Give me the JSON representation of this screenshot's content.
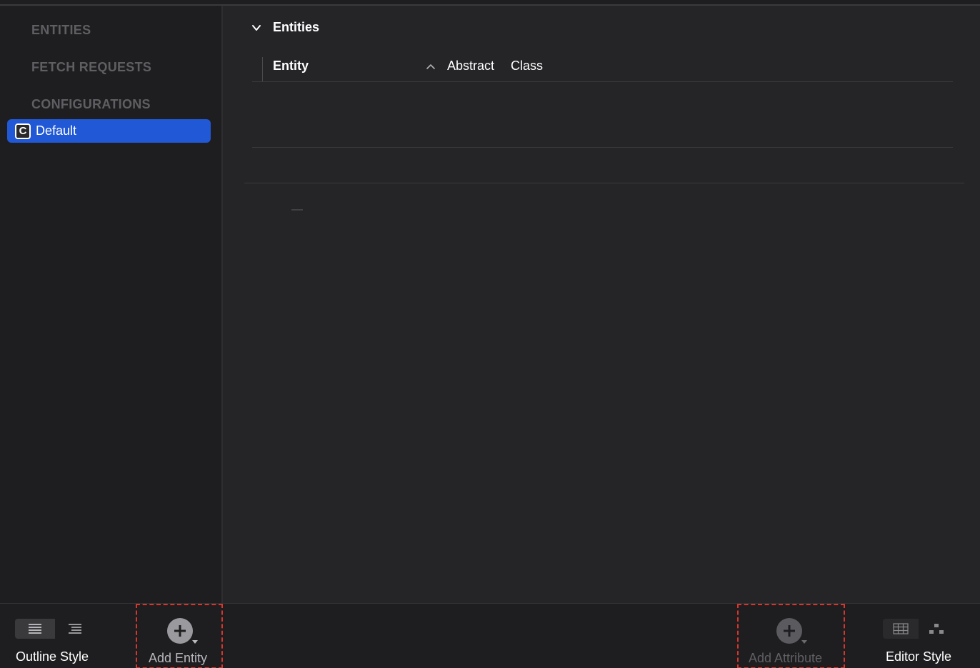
{
  "sidebar": {
    "sections": {
      "entities": "ENTITIES",
      "fetch_requests": "FETCH REQUESTS",
      "configurations": "CONFIGURATIONS"
    },
    "items": [
      {
        "label": "Default",
        "icon_letter": "C",
        "icon": "configuration-icon",
        "selected": true
      }
    ]
  },
  "main": {
    "section_title": "Entities",
    "table": {
      "columns": [
        "Entity",
        "Abstract",
        "Class"
      ],
      "sort_column": "Entity",
      "rows": []
    },
    "placeholder": "—"
  },
  "toolbar": {
    "outline_style_label": "Outline Style",
    "add_entity_label": "Add Entity",
    "add_attribute_label": "Add Attribute",
    "editor_style_label": "Editor Style"
  },
  "colors": {
    "selection": "#2158d6",
    "highlight_outline": "#d8362c",
    "background": "#1e1e20",
    "main_background": "#252427"
  }
}
